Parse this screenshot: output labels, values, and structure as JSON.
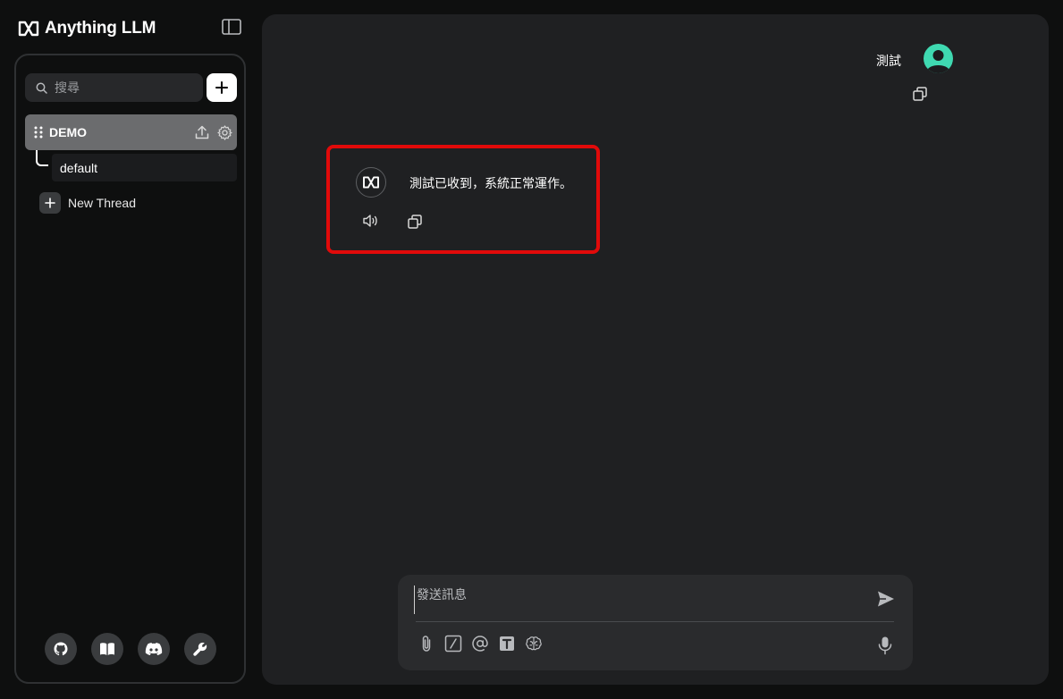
{
  "brand": {
    "name": "Anything LLM"
  },
  "sidebar": {
    "search": {
      "placeholder": "搜尋"
    },
    "workspace": {
      "name": "DEMO",
      "threads": [
        {
          "label": "default"
        }
      ],
      "new_thread_label": "New Thread"
    },
    "footer_icons": [
      "github-icon",
      "book-icon",
      "discord-icon",
      "wrench-icon"
    ]
  },
  "chat": {
    "messages": [
      {
        "role": "user",
        "text": "測試"
      },
      {
        "role": "assistant",
        "text": "測試已收到，系統正常運作。"
      }
    ]
  },
  "prompt": {
    "placeholder": "發送訊息"
  },
  "colors": {
    "background": "#0e0f0f",
    "panel": "#1f2022",
    "workspace_active": "#6b6c6e",
    "user_avatar": "#3fd9b1",
    "highlight": "#e10a0a"
  }
}
